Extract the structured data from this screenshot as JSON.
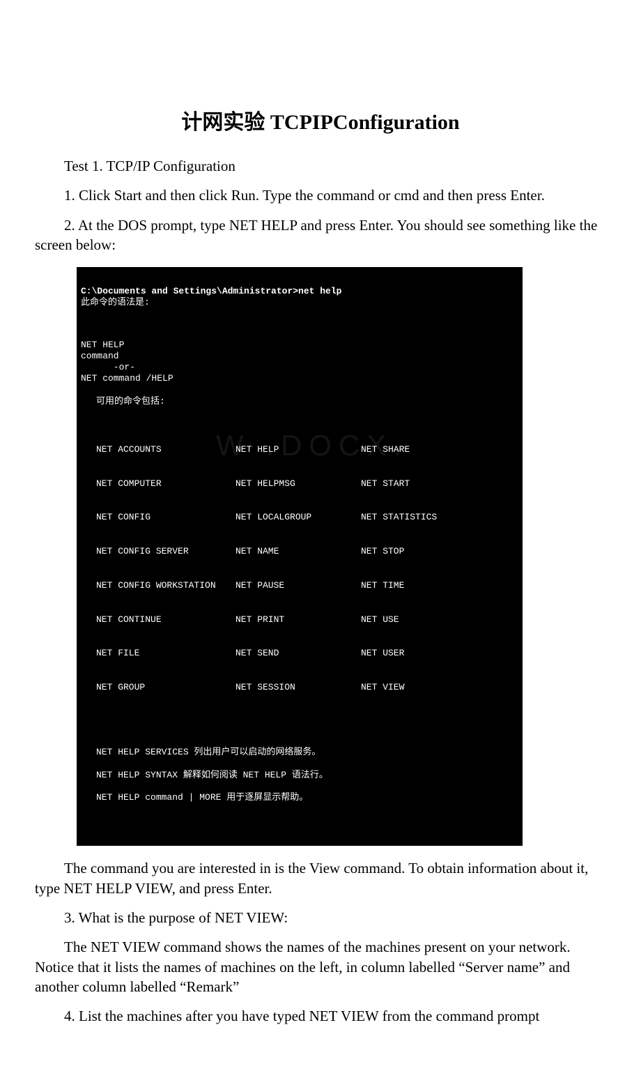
{
  "title": "计网实验 TCPIPConfiguration",
  "paragraphs": {
    "p1": "Test 1. TCP/IP Configuration",
    "p2": "1. Click Start and then click Run. Type the command or cmd and then press Enter.",
    "p3": "2. At the DOS prompt, type NET HELP and press Enter. You should see something like the screen below:",
    "p4": "The command you are interested in is the View command. To obtain information about it, type NET HELP VIEW, and press Enter.",
    "p5": "3. What is the purpose of NET VIEW:",
    "p6": "The NET VIEW command shows the names of the machines present on your network. Notice that it lists the names of machines on the left, in column labelled “Server name” and another column labelled “Remark”",
    "p7": "4. List the machines after you have typed NET VIEW from the command prompt"
  },
  "terminal": {
    "prompt": "C:\\Documents and Settings\\Administrator>net help",
    "syntax_label": "此命令的语法是:",
    "usage": {
      "l1": "NET HELP",
      "l2": "command",
      "l3": "      -or-",
      "l4": "NET command /HELP"
    },
    "available_label": "可用的命令包括:",
    "columns": {
      "col1": [
        "NET ACCOUNTS",
        "NET COMPUTER",
        "NET CONFIG",
        "NET CONFIG SERVER",
        "NET CONFIG WORKSTATION",
        "NET CONTINUE",
        "NET FILE",
        "NET GROUP"
      ],
      "col2": [
        "NET HELP",
        "NET HELPMSG",
        "NET LOCALGROUP",
        "NET NAME",
        "NET PAUSE",
        "NET PRINT",
        "NET SEND",
        "NET SESSION"
      ],
      "col3": [
        "NET SHARE",
        "NET START",
        "NET STATISTICS",
        "NET STOP",
        "NET TIME",
        "NET USE",
        "NET USER",
        "NET VIEW"
      ]
    },
    "footer": {
      "f1": "NET HELP SERVICES 列出用户可以启动的网络服务。",
      "f2": "NET HELP SYNTAX 解释如何阅读 NET HELP 语法行。",
      "f3": "NET HELP command | MORE 用于逐屏显示帮助。"
    },
    "watermark": "W .DOCX."
  }
}
